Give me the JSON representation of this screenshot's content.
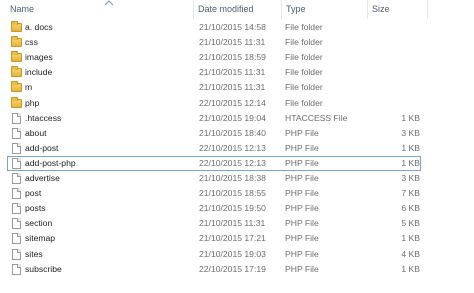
{
  "columns": {
    "name": "Name",
    "date": "Date modified",
    "type": "Type",
    "size": "Size"
  },
  "sort": {
    "column": "name",
    "icon": "sort-ascending-icon"
  },
  "colors": {
    "header_text": "#4c607a",
    "selection_border": "#7da2ce",
    "folder": "#f0c755"
  },
  "files": [
    {
      "name": "a. docs",
      "date": "21/10/2015 14:58",
      "type": "File folder",
      "size": "",
      "icon": "folder-icon",
      "selected": false
    },
    {
      "name": "css",
      "date": "21/10/2015 11:31",
      "type": "File folder",
      "size": "",
      "icon": "folder-icon",
      "selected": false
    },
    {
      "name": "images",
      "date": "21/10/2015 18:59",
      "type": "File folder",
      "size": "",
      "icon": "folder-icon",
      "selected": false
    },
    {
      "name": "include",
      "date": "21/10/2015 11:31",
      "type": "File folder",
      "size": "",
      "icon": "folder-icon",
      "selected": false
    },
    {
      "name": "m",
      "date": "21/10/2015 11:31",
      "type": "File folder",
      "size": "",
      "icon": "folder-icon",
      "selected": false
    },
    {
      "name": "php",
      "date": "22/10/2015 12:14",
      "type": "File folder",
      "size": "",
      "icon": "folder-icon",
      "selected": false
    },
    {
      "name": ".htaccess",
      "date": "21/10/2015 19:04",
      "type": "HTACCESS File",
      "size": "1 KB",
      "icon": "file-icon",
      "selected": false
    },
    {
      "name": "about",
      "date": "21/10/2015 18:40",
      "type": "PHP File",
      "size": "3 KB",
      "icon": "file-icon",
      "selected": false
    },
    {
      "name": "add-post",
      "date": "22/10/2015 12:13",
      "type": "PHP File",
      "size": "1 KB",
      "icon": "file-icon",
      "selected": false
    },
    {
      "name": "add-post-php",
      "date": "22/10/2015 12:13",
      "type": "PHP File",
      "size": "1 KB",
      "icon": "file-icon",
      "selected": true
    },
    {
      "name": "advertise",
      "date": "21/10/2015 18:38",
      "type": "PHP File",
      "size": "3 KB",
      "icon": "file-icon",
      "selected": false
    },
    {
      "name": "post",
      "date": "21/10/2015 18:55",
      "type": "PHP File",
      "size": "7 KB",
      "icon": "file-icon",
      "selected": false
    },
    {
      "name": "posts",
      "date": "21/10/2015 19:50",
      "type": "PHP File",
      "size": "6 KB",
      "icon": "file-icon",
      "selected": false
    },
    {
      "name": "section",
      "date": "21/10/2015 11:31",
      "type": "PHP File",
      "size": "5 KB",
      "icon": "file-icon",
      "selected": false
    },
    {
      "name": "sitemap",
      "date": "21/10/2015 17:21",
      "type": "PHP File",
      "size": "1 KB",
      "icon": "file-icon",
      "selected": false
    },
    {
      "name": "sites",
      "date": "21/10/2015 19:03",
      "type": "PHP File",
      "size": "4 KB",
      "icon": "file-icon",
      "selected": false
    },
    {
      "name": "subscribe",
      "date": "22/10/2015 17:19",
      "type": "PHP File",
      "size": "1 KB",
      "icon": "file-icon",
      "selected": false
    }
  ]
}
